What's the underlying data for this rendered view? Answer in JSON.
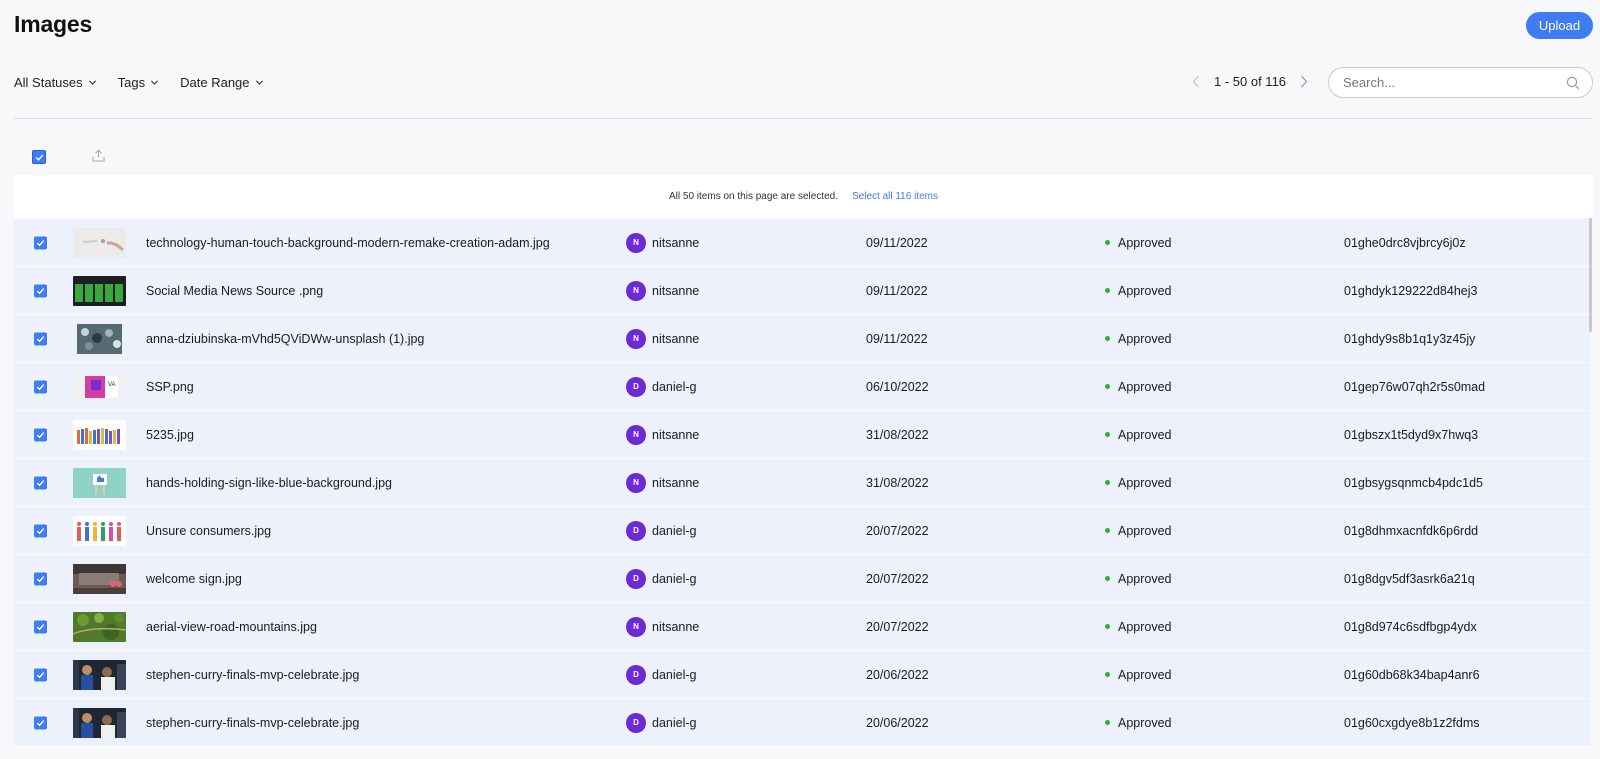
{
  "header": {
    "title": "Images",
    "upload_label": "Upload"
  },
  "filters": [
    {
      "label": "All Statuses"
    },
    {
      "label": "Tags"
    },
    {
      "label": "Date Range"
    }
  ],
  "pagination": {
    "text": "1 - 50 of 116"
  },
  "search": {
    "placeholder": "Search..."
  },
  "banner": {
    "message": "All 50 items on this page are selected.",
    "link": "Select all 116 items"
  },
  "colors": {
    "accent": "#3f7bf3",
    "avatar": "#6a2ad6",
    "approved": "#2bb52b",
    "row_selected": "#edf1fc"
  },
  "rows": [
    {
      "file": "technology-human-touch-background-modern-remake-creation-adam.jpg",
      "initial": "N",
      "user": "nitsanne",
      "date": "09/11/2022",
      "status": "Approved",
      "id": "01ghe0drc8vjbrcy6j0z",
      "thumb": "touch"
    },
    {
      "file": "Social Media News Source .png",
      "initial": "N",
      "user": "nitsanne",
      "date": "09/11/2022",
      "status": "Approved",
      "id": "01ghdyk129222d84hej3",
      "thumb": "bars"
    },
    {
      "file": "anna-dziubinska-mVhd5QViDWw-unsplash (1).jpg",
      "initial": "N",
      "user": "nitsanne",
      "date": "09/11/2022",
      "status": "Approved",
      "id": "01ghdy9s8b1q1y3z45jy",
      "thumb": "crowd"
    },
    {
      "file": "SSP.png",
      "initial": "D",
      "user": "daniel-g",
      "date": "06/10/2022",
      "status": "Approved",
      "id": "01gep76w07qh2r5s0mad",
      "thumb": "ssp"
    },
    {
      "file": "5235.jpg",
      "initial": "N",
      "user": "nitsanne",
      "date": "31/08/2022",
      "status": "Approved",
      "id": "01gbszx1t5dyd9x7hwq3",
      "thumb": "people"
    },
    {
      "file": "hands-holding-sign-like-blue-background.jpg",
      "initial": "N",
      "user": "nitsanne",
      "date": "31/08/2022",
      "status": "Approved",
      "id": "01gbsygsqnmcb4pdc1d5",
      "thumb": "like"
    },
    {
      "file": "Unsure consumers.jpg",
      "initial": "D",
      "user": "daniel-g",
      "date": "20/07/2022",
      "status": "Approved",
      "id": "01g8dhmxacnfdk6p6rdd",
      "thumb": "consumers"
    },
    {
      "file": "welcome sign.jpg",
      "initial": "D",
      "user": "daniel-g",
      "date": "20/07/2022",
      "status": "Approved",
      "id": "01g8dgv5df3asrk6a21q",
      "thumb": "welcome"
    },
    {
      "file": "aerial-view-road-mountains.jpg",
      "initial": "N",
      "user": "nitsanne",
      "date": "20/07/2022",
      "status": "Approved",
      "id": "01g8d974c6sdfbgp4ydx",
      "thumb": "aerial"
    },
    {
      "file": "stephen-curry-finals-mvp-celebrate.jpg",
      "initial": "D",
      "user": "daniel-g",
      "date": "20/06/2022",
      "status": "Approved",
      "id": "01g60db68k34bap4anr6",
      "thumb": "curry"
    },
    {
      "file": "stephen-curry-finals-mvp-celebrate.jpg",
      "initial": "D",
      "user": "daniel-g",
      "date": "20/06/2022",
      "status": "Approved",
      "id": "01g60cxgdye8b1z2fdms",
      "thumb": "curry"
    }
  ]
}
